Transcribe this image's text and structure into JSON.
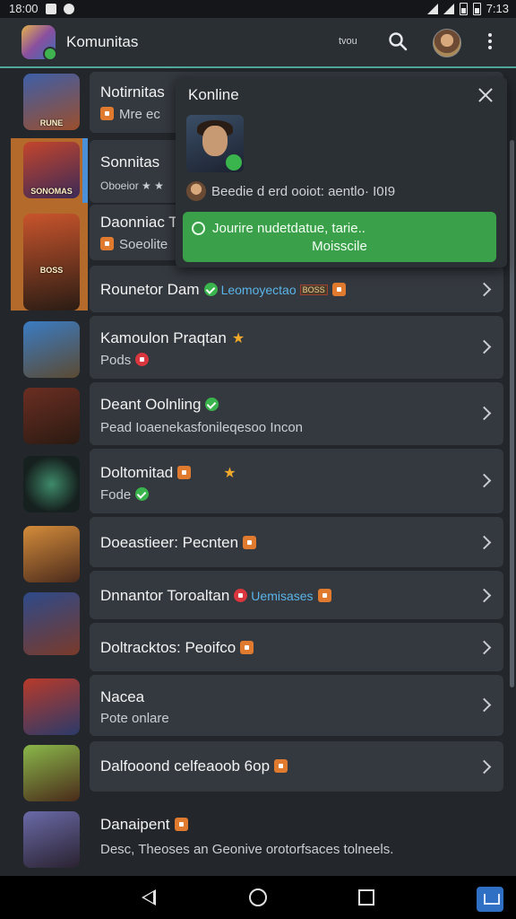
{
  "status_bar": {
    "time_left": "18:00",
    "time_right": "7:13"
  },
  "app_bar": {
    "title": "Komunitas",
    "small_label": "tvou"
  },
  "popup": {
    "title": "Konline",
    "status_line": "Beedie d erd ooiot: aentlo· I0I9",
    "button_line1": "Jourire nudetdatue, tarie..",
    "button_line2": "Moisscile"
  },
  "list": {
    "items": [
      {
        "thumb_label": "RUNE",
        "title": "Notirnitas",
        "sub": "Mre ec"
      },
      {
        "thumb_label": "SONOMAS",
        "title": "Sonnitas",
        "sub": "Oboeior ★ ★"
      },
      {
        "thumb_label": "BOSS",
        "title": "Daonniac T",
        "sub": "Soeolite"
      },
      {
        "title": "Rounetor Dam",
        "tag": "Leomoyectao",
        "chip": "BOSS"
      },
      {
        "title": "Kamoulon Praqtan",
        "sub": "Pods"
      },
      {
        "title": "Deant Oolnling",
        "sub": "Pead Ioaenekasfonileqesoo Incon"
      },
      {
        "title": "Doltomitad",
        "sub": "Fode"
      },
      {
        "title": "Doeastieer: Pecnten"
      },
      {
        "title": "Dnnantor Toroaltan",
        "tag": "Uemisases"
      },
      {
        "title": "Doltracktos: Peoifco"
      },
      {
        "title": "Nacea",
        "sub": "Pote onlare"
      },
      {
        "title": "Dalfooond celfeaoob 6op"
      },
      {
        "title": "Danaipent",
        "sub": "Desc, Theoses an Geonive orotorfsaces tolneels."
      }
    ]
  },
  "colors": {
    "accent": "#4fa89a",
    "button_green": "#3aa04a",
    "card": "#34393f",
    "badge_green": "#3ab44c",
    "badge_red": "#d9363e",
    "badge_orange": "#e07a2e"
  },
  "icons": [
    "search-icon",
    "more-vert-icon",
    "close-icon",
    "chevron-right-icon",
    "back-icon",
    "home-icon",
    "recents-icon"
  ]
}
